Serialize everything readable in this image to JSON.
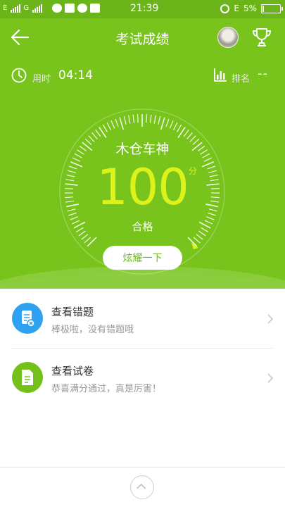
{
  "status_bar": {
    "left_net_1": "E",
    "left_net_2": "G",
    "time": "21:39",
    "right_net": "E",
    "battery": "5%"
  },
  "header": {
    "title": "考试成绩"
  },
  "stats": {
    "time_label": "用时",
    "time_value": "04:14",
    "rank_label": "排名",
    "rank_value": "--"
  },
  "result": {
    "rank_title": "木仓车神",
    "score": "100",
    "score_unit": "分",
    "pass_text": "合格",
    "share_button": "炫耀一下"
  },
  "list": [
    {
      "title": "查看错题",
      "subtitle": "棒极啦，没有错题哦",
      "icon": "wrong-questions-icon",
      "icon_color": "#2ea2f0"
    },
    {
      "title": "查看试卷",
      "subtitle": "恭喜满分通过，真是厉害！",
      "icon": "paper-icon",
      "icon_color": "#75c11b"
    }
  ],
  "colors": {
    "primary_green": "#78c31c",
    "score_yellow": "#dcf21a",
    "blue": "#2ea2f0"
  }
}
